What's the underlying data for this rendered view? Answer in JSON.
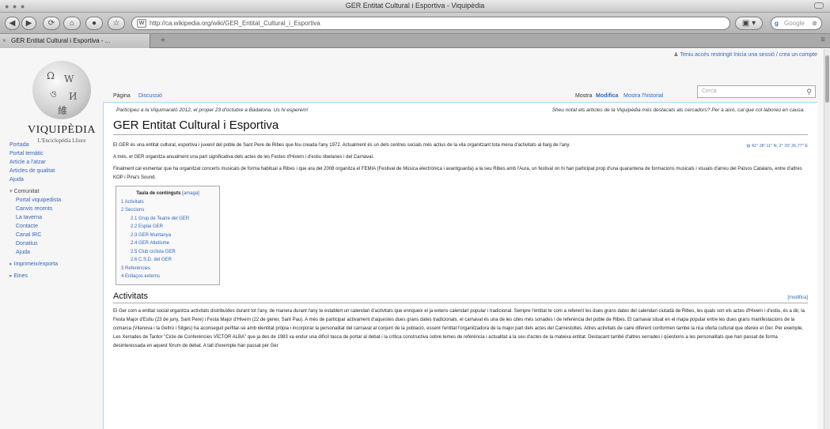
{
  "browser": {
    "window_title": "GER Entitat Cultural i Esportiva - Viquipèdia",
    "url": "http://ca.wikipedia.org/wiki/GER_Entitat_Cultural_i_Esportiva",
    "search_placeholder": "Google",
    "tab_title": "GER Entitat Cultural i Esportiva - ...",
    "buttons": {
      "back": "◀",
      "forward": "▶",
      "reload": "⟳",
      "home": "⌂",
      "add": "+"
    }
  },
  "personal_tools": "Teniu accés restringit  Inicia una sessió / crea un compte",
  "logo": {
    "wordmark": "VIQUIPÈDIA",
    "tagline": "L'Enciclopèdia Lliure"
  },
  "sidebar": {
    "nav": [
      "Portada",
      "Portal temàtic",
      "Article a l'atzar",
      "Articles de qualitat",
      "Ajuda"
    ],
    "community_title": "Comunitat",
    "community": [
      "Portal viquipedista",
      "Canvis recents",
      "La taverna",
      "Contacte",
      "Canal IRC",
      "Donatius",
      "Ajuda"
    ],
    "more": [
      "Imprimeix/exporta",
      "Eines"
    ]
  },
  "page_tabs": {
    "page": "Pàgina",
    "discussion": "Discussió",
    "read": "Mostra",
    "edit": "Modifica",
    "history": "Mostra l'historial"
  },
  "wiki_search_placeholder": "Cerca",
  "notice": {
    "left": "Participeu a la Viquimarató 2012, el proper 23 d'octubre a Badalona. Us hi esperem!",
    "right": "Sheu notat els articles de la Viquipèdia més destacats als cercadors? Per a això, cal que col·laboreu en causa."
  },
  "article": {
    "title": "GER Entitat Cultural i Esportiva",
    "coords": "41° 28' 11\" N, 2° 20' 26.77\" E",
    "paragraphs": [
      "El GER és una entitat cultural, esportiva i juvenil del poble de Sant Pere de Ribes que fou creada l'any 1972. Actualment és un dels centres socials més actius de la vila organitzant tota mena d'activitats al llarg de l'any.",
      "A més, el GER organitza anualment una part significativa dels actes de les Festes d'Hivern i d'estiu ribetanes i del Carnaval.",
      "Finalment cal esmentar que ha organitzat concerts musicals de forma habitual a Ribes i que ara del 2008 organitza el FEMIA (Festival de Música electrònica i avantguarda) a la seu Ribes amb l'Aura, un festival on hi han participat prop d'una quarantena de formacions musicals i visuals d'arreu del Països Catalans, entre d'altres KOP i Pina's Sound."
    ],
    "toc": {
      "title": "Taula de continguts",
      "toggle": "[amaga]",
      "items": [
        {
          "label": "1 Activitats",
          "level": 1
        },
        {
          "label": "2 Seccions",
          "level": 1
        },
        {
          "label": "2.1 Grup de Teatre del GER",
          "level": 2
        },
        {
          "label": "2.2 Esplai GER",
          "level": 2
        },
        {
          "label": "2.3 GER Muntanya",
          "level": 2
        },
        {
          "label": "2.4 GER Atletisme",
          "level": 2
        },
        {
          "label": "2.5 Club ciclista GER",
          "level": 2
        },
        {
          "label": "2.6 C.S.D. del GER",
          "level": 2
        },
        {
          "label": "3 Referències",
          "level": 1
        },
        {
          "label": "4 Enllaços externs",
          "level": 1
        }
      ]
    },
    "section_title": "Activitats",
    "section_edit": "[modifica]",
    "section_text": "El Ger com a entitat social organitza activitats distribuïdes durant tot l'any, de manera durant l'any te establert un calendari d'activitats que enriqueix el ja extens calendari popular i tradicional. Sempre l'entitat te com a referent les dues grans dates del calendari ciutadà de Ribes, les quals son els actes d'Hivern i d'estiu, és a dir, la Festa Major d'Estiu (23 de juny, Sant Pere) i Festa Major d'Hivern (22 de gener, Sant Pau). A més de participar activament d'aquestes dues grans dates tradicionals, el carnaval és una de les cites més sonades i de referència del poble de Ribes. El carnaval situat en el mapa popular entre les dues grans manifestacions de la comarca (Vilanova i la Geltrú i Sitges) ha aconseguit perfilar-se amb identitat pròpia i incorporar la personalitat del carnaval al conjunt de la població, essent l'entitat l'organitzadora de la major part dels actes del Carnestoltes. Altres activitats de caire diferent conformen també la rica oferta cultural que ofereix el Ger. Per exemple, Les Xerrades de Tardor \"Cicle de Conferències VÍCTOR ALBA\" que ja des de 1983 va endur una difícil tasca de portar al debat i la crítica constructiva sobre temes de referència i actualitat a la seu d'actes de la mateixa entitat. Destacant també d'altres xerrades i qüestions a les personalitats que han passat de forma desinteressada en aquest fòrum de debat. A tall d'exemple han passat per Ger"
  }
}
